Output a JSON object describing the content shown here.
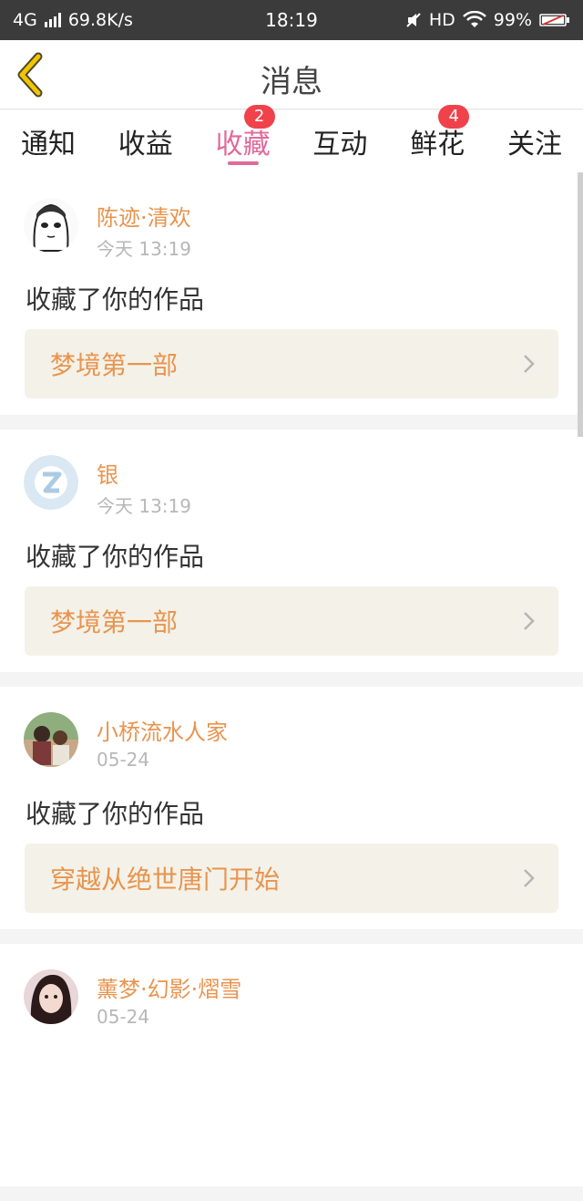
{
  "status": {
    "network": "4G",
    "speed": "69.8K/s",
    "time": "18:19",
    "hd": "HD",
    "battery": "99%"
  },
  "header": {
    "title": "消息"
  },
  "tabs": [
    {
      "label": "通知",
      "badge": null
    },
    {
      "label": "收益",
      "badge": null
    },
    {
      "label": "收藏",
      "badge": "2",
      "active": true
    },
    {
      "label": "互动",
      "badge": null
    },
    {
      "label": "鲜花",
      "badge": "4"
    },
    {
      "label": "关注",
      "badge": null
    }
  ],
  "messages": [
    {
      "user": "陈迹·清欢",
      "time": "今天 13:19",
      "action": "收藏了你的作品",
      "work": "梦境第一部"
    },
    {
      "user": "银",
      "time": "今天 13:19",
      "action": "收藏了你的作品",
      "work": "梦境第一部"
    },
    {
      "user": "小桥流水人家",
      "time": "05-24",
      "action": "收藏了你的作品",
      "work": "穿越从绝世唐门开始"
    },
    {
      "user": "薰梦·幻影·熠雪",
      "time": "05-24",
      "action": "",
      "work": ""
    }
  ],
  "colors": {
    "accent_pink": "#e06a9a",
    "name_orange": "#e8944f",
    "badge_red": "#f0424b",
    "back_yellow": "#f5c400"
  }
}
